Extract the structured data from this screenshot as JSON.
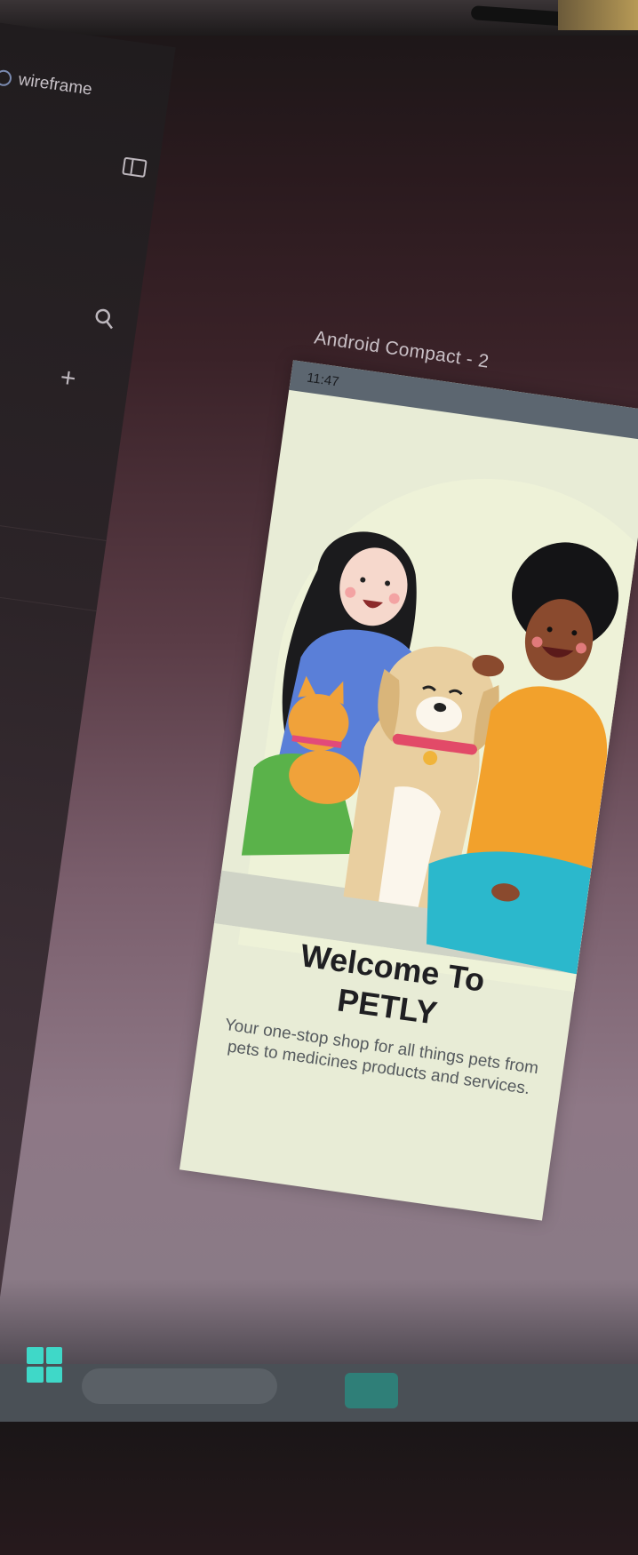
{
  "editor": {
    "file_name": "wireframe",
    "frame_label": "Android Compact - 2"
  },
  "phone": {
    "status_time": "11:47",
    "welcome_line1": "Welcome To",
    "welcome_line2": "PETLY",
    "subtitle": "Your one-stop shop for all things pets from pets to medicines products and services."
  },
  "colors": {
    "accent_teal": "#3fd8c8",
    "phone_bg": "#e8ecd6",
    "shirt_blue": "#5a7fd8",
    "shirt_orange": "#f2a12c",
    "pants_teal": "#2bb8cc"
  },
  "icons": [
    "sidebar-toggle-icon",
    "search-icon",
    "plus-icon",
    "windows-start-icon"
  ]
}
